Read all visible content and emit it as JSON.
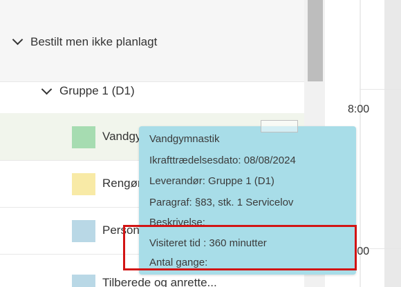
{
  "tree": {
    "group_header": "Bestilt men ikke planlagt",
    "subgroup": "Gruppe 1 (D1)",
    "items": [
      {
        "label": "Vandgymnastik",
        "color": "#a6dcb1"
      },
      {
        "label": "Rengøring",
        "color": "#f8eaa6"
      },
      {
        "label": "Personlig pleje",
        "color": "#b9d8e6"
      },
      {
        "label": "Tilberede og anrette...",
        "color": "#b9d8e6"
      }
    ]
  },
  "calendar": {
    "times": [
      "8:00",
      "9:00"
    ]
  },
  "tooltip": {
    "title": "Vandgymnastik",
    "effective_date": "Ikrafttrædelsesdato: 08/08/2024",
    "supplier": "Leverandør: Gruppe 1 (D1)",
    "paragraph": "Paragraf: §83, stk. 1 Servicelov",
    "description": "Beskrivelse:",
    "visited_time": "Visiteret tid : 360 minutter",
    "count": "Antal gange:"
  },
  "colors": {
    "tooltip_bg": "#a8dde8",
    "highlight": "#d21414"
  }
}
